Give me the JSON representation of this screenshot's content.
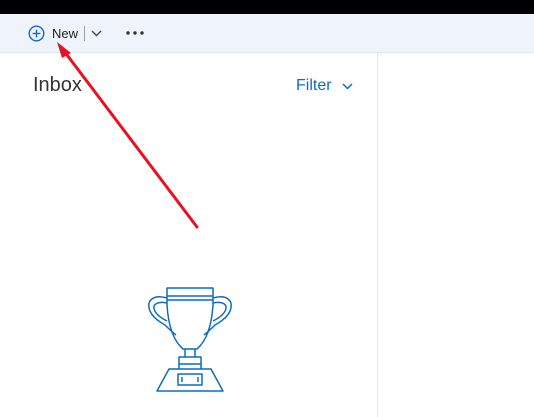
{
  "toolbar": {
    "new_label": "New",
    "new_icon": "plus-circle-icon",
    "chevron_icon": "chevron-down-icon",
    "more_icon": "more-horizontal-icon"
  },
  "list": {
    "title": "Inbox",
    "filter_label": "Filter",
    "filter_icon": "chevron-down-icon",
    "empty_state_icon": "trophy-icon"
  },
  "annotation": {
    "arrow_color": "#e81123"
  },
  "colors": {
    "accent": "#0f6cbd",
    "commandbar_bg": "#eff4fc"
  }
}
